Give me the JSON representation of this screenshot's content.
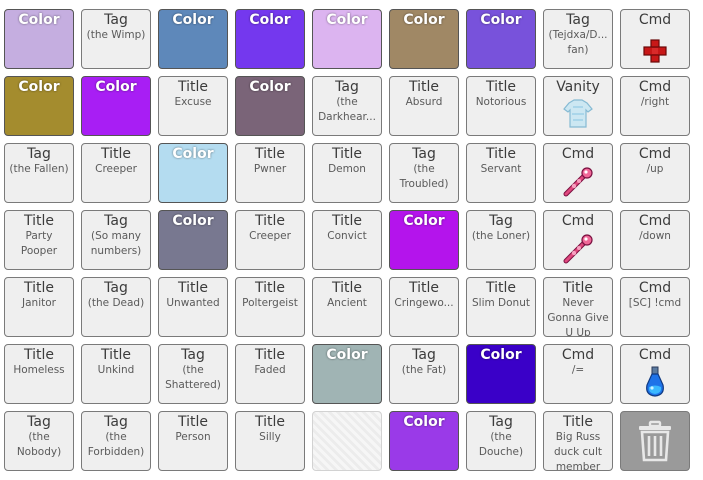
{
  "tiles": [
    {
      "kind": "color",
      "label": "Color",
      "color": "#c5aee0"
    },
    {
      "kind": "text",
      "label": "Tag",
      "sub": "(the Wimp)"
    },
    {
      "kind": "color",
      "label": "Color",
      "color": "#5e88ba"
    },
    {
      "kind": "color",
      "label": "Color",
      "color": "#7438ee"
    },
    {
      "kind": "color",
      "label": "Color",
      "color": "#dcb4f0"
    },
    {
      "kind": "color",
      "label": "Color",
      "color": "#a08865"
    },
    {
      "kind": "color",
      "label": "Color",
      "color": "#7852db"
    },
    {
      "kind": "text",
      "label": "Tag",
      "sub": "(Tejdxa/D... fan)"
    },
    {
      "kind": "cmd",
      "label": "Cmd",
      "icon": "red-cross-icon"
    },
    {
      "kind": "color",
      "label": "Color",
      "color": "#a48c2e"
    },
    {
      "kind": "color",
      "label": "Color",
      "color": "#a81ef4"
    },
    {
      "kind": "text",
      "label": "Title",
      "sub": "Excuse"
    },
    {
      "kind": "color",
      "label": "Color",
      "color": "#7a6478"
    },
    {
      "kind": "text",
      "label": "Tag",
      "sub": "(the Darkhear..."
    },
    {
      "kind": "text",
      "label": "Title",
      "sub": "Absurd"
    },
    {
      "kind": "text",
      "label": "Title",
      "sub": "Notorious"
    },
    {
      "kind": "cmd",
      "label": "Vanity",
      "icon": "ghost-shirt-icon"
    },
    {
      "kind": "text",
      "label": "Cmd",
      "sub": "/right"
    },
    {
      "kind": "text",
      "label": "Tag",
      "sub": "(the Fallen)"
    },
    {
      "kind": "text",
      "label": "Title",
      "sub": "Creeper"
    },
    {
      "kind": "color",
      "label": "Color",
      "color": "#b4dcf0"
    },
    {
      "kind": "text",
      "label": "Title",
      "sub": "Pwner"
    },
    {
      "kind": "text",
      "label": "Title",
      "sub": "Demon"
    },
    {
      "kind": "text",
      "label": "Tag",
      "sub": "(the Troubled)"
    },
    {
      "kind": "text",
      "label": "Title",
      "sub": "Servant"
    },
    {
      "kind": "cmd",
      "label": "Cmd",
      "icon": "pink-wand-icon"
    },
    {
      "kind": "text",
      "label": "Cmd",
      "sub": "/up"
    },
    {
      "kind": "text",
      "label": "Title",
      "sub": "Party Pooper"
    },
    {
      "kind": "text",
      "label": "Tag",
      "sub": "(So many numbers)"
    },
    {
      "kind": "color",
      "label": "Color",
      "color": "#787890"
    },
    {
      "kind": "text",
      "label": "Title",
      "sub": "Creeper"
    },
    {
      "kind": "text",
      "label": "Title",
      "sub": "Convict"
    },
    {
      "kind": "color",
      "label": "Color",
      "color": "#b414ec"
    },
    {
      "kind": "text",
      "label": "Tag",
      "sub": "(the Loner)"
    },
    {
      "kind": "cmd",
      "label": "Cmd",
      "icon": "pink-wand-icon"
    },
    {
      "kind": "text",
      "label": "Cmd",
      "sub": "/down"
    },
    {
      "kind": "text",
      "label": "Title",
      "sub": "Janitor"
    },
    {
      "kind": "text",
      "label": "Tag",
      "sub": "(the Dead)"
    },
    {
      "kind": "text",
      "label": "Title",
      "sub": "Unwanted"
    },
    {
      "kind": "text",
      "label": "Title",
      "sub": "Poltergeist"
    },
    {
      "kind": "text",
      "label": "Title",
      "sub": "Ancient"
    },
    {
      "kind": "text",
      "label": "Title",
      "sub": "Cringewo..."
    },
    {
      "kind": "text",
      "label": "Title",
      "sub": "Slim Donut"
    },
    {
      "kind": "text",
      "label": "Title",
      "sub": "Never Gonna Give U Up"
    },
    {
      "kind": "text",
      "label": "Cmd",
      "sub": "[SC] !cmd"
    },
    {
      "kind": "text",
      "label": "Title",
      "sub": "Homeless"
    },
    {
      "kind": "text",
      "label": "Title",
      "sub": "Unkind"
    },
    {
      "kind": "text",
      "label": "Tag",
      "sub": "(the Shattered)"
    },
    {
      "kind": "text",
      "label": "Title",
      "sub": "Faded"
    },
    {
      "kind": "color",
      "label": "Color",
      "color": "#a0b4b4"
    },
    {
      "kind": "text",
      "label": "Tag",
      "sub": "(the Fat)"
    },
    {
      "kind": "color",
      "label": "Color",
      "color": "#3a00c8"
    },
    {
      "kind": "text",
      "label": "Cmd",
      "sub": "/="
    },
    {
      "kind": "cmd",
      "label": "Cmd",
      "icon": "blue-potion-icon"
    },
    {
      "kind": "text",
      "label": "Tag",
      "sub": "(the Nobody)"
    },
    {
      "kind": "text",
      "label": "Tag",
      "sub": "(the Forbidden)"
    },
    {
      "kind": "text",
      "label": "Title",
      "sub": "Person"
    },
    {
      "kind": "text",
      "label": "Title",
      "sub": "Silly"
    },
    {
      "kind": "empty"
    },
    {
      "kind": "color",
      "label": "Color",
      "color": "#9a3ae8"
    },
    {
      "kind": "text",
      "label": "Tag",
      "sub": "(the Douche)"
    },
    {
      "kind": "text",
      "label": "Title",
      "sub": "Big Russ duck cult member"
    },
    {
      "kind": "trash",
      "icon": "trash-can-icon"
    }
  ]
}
